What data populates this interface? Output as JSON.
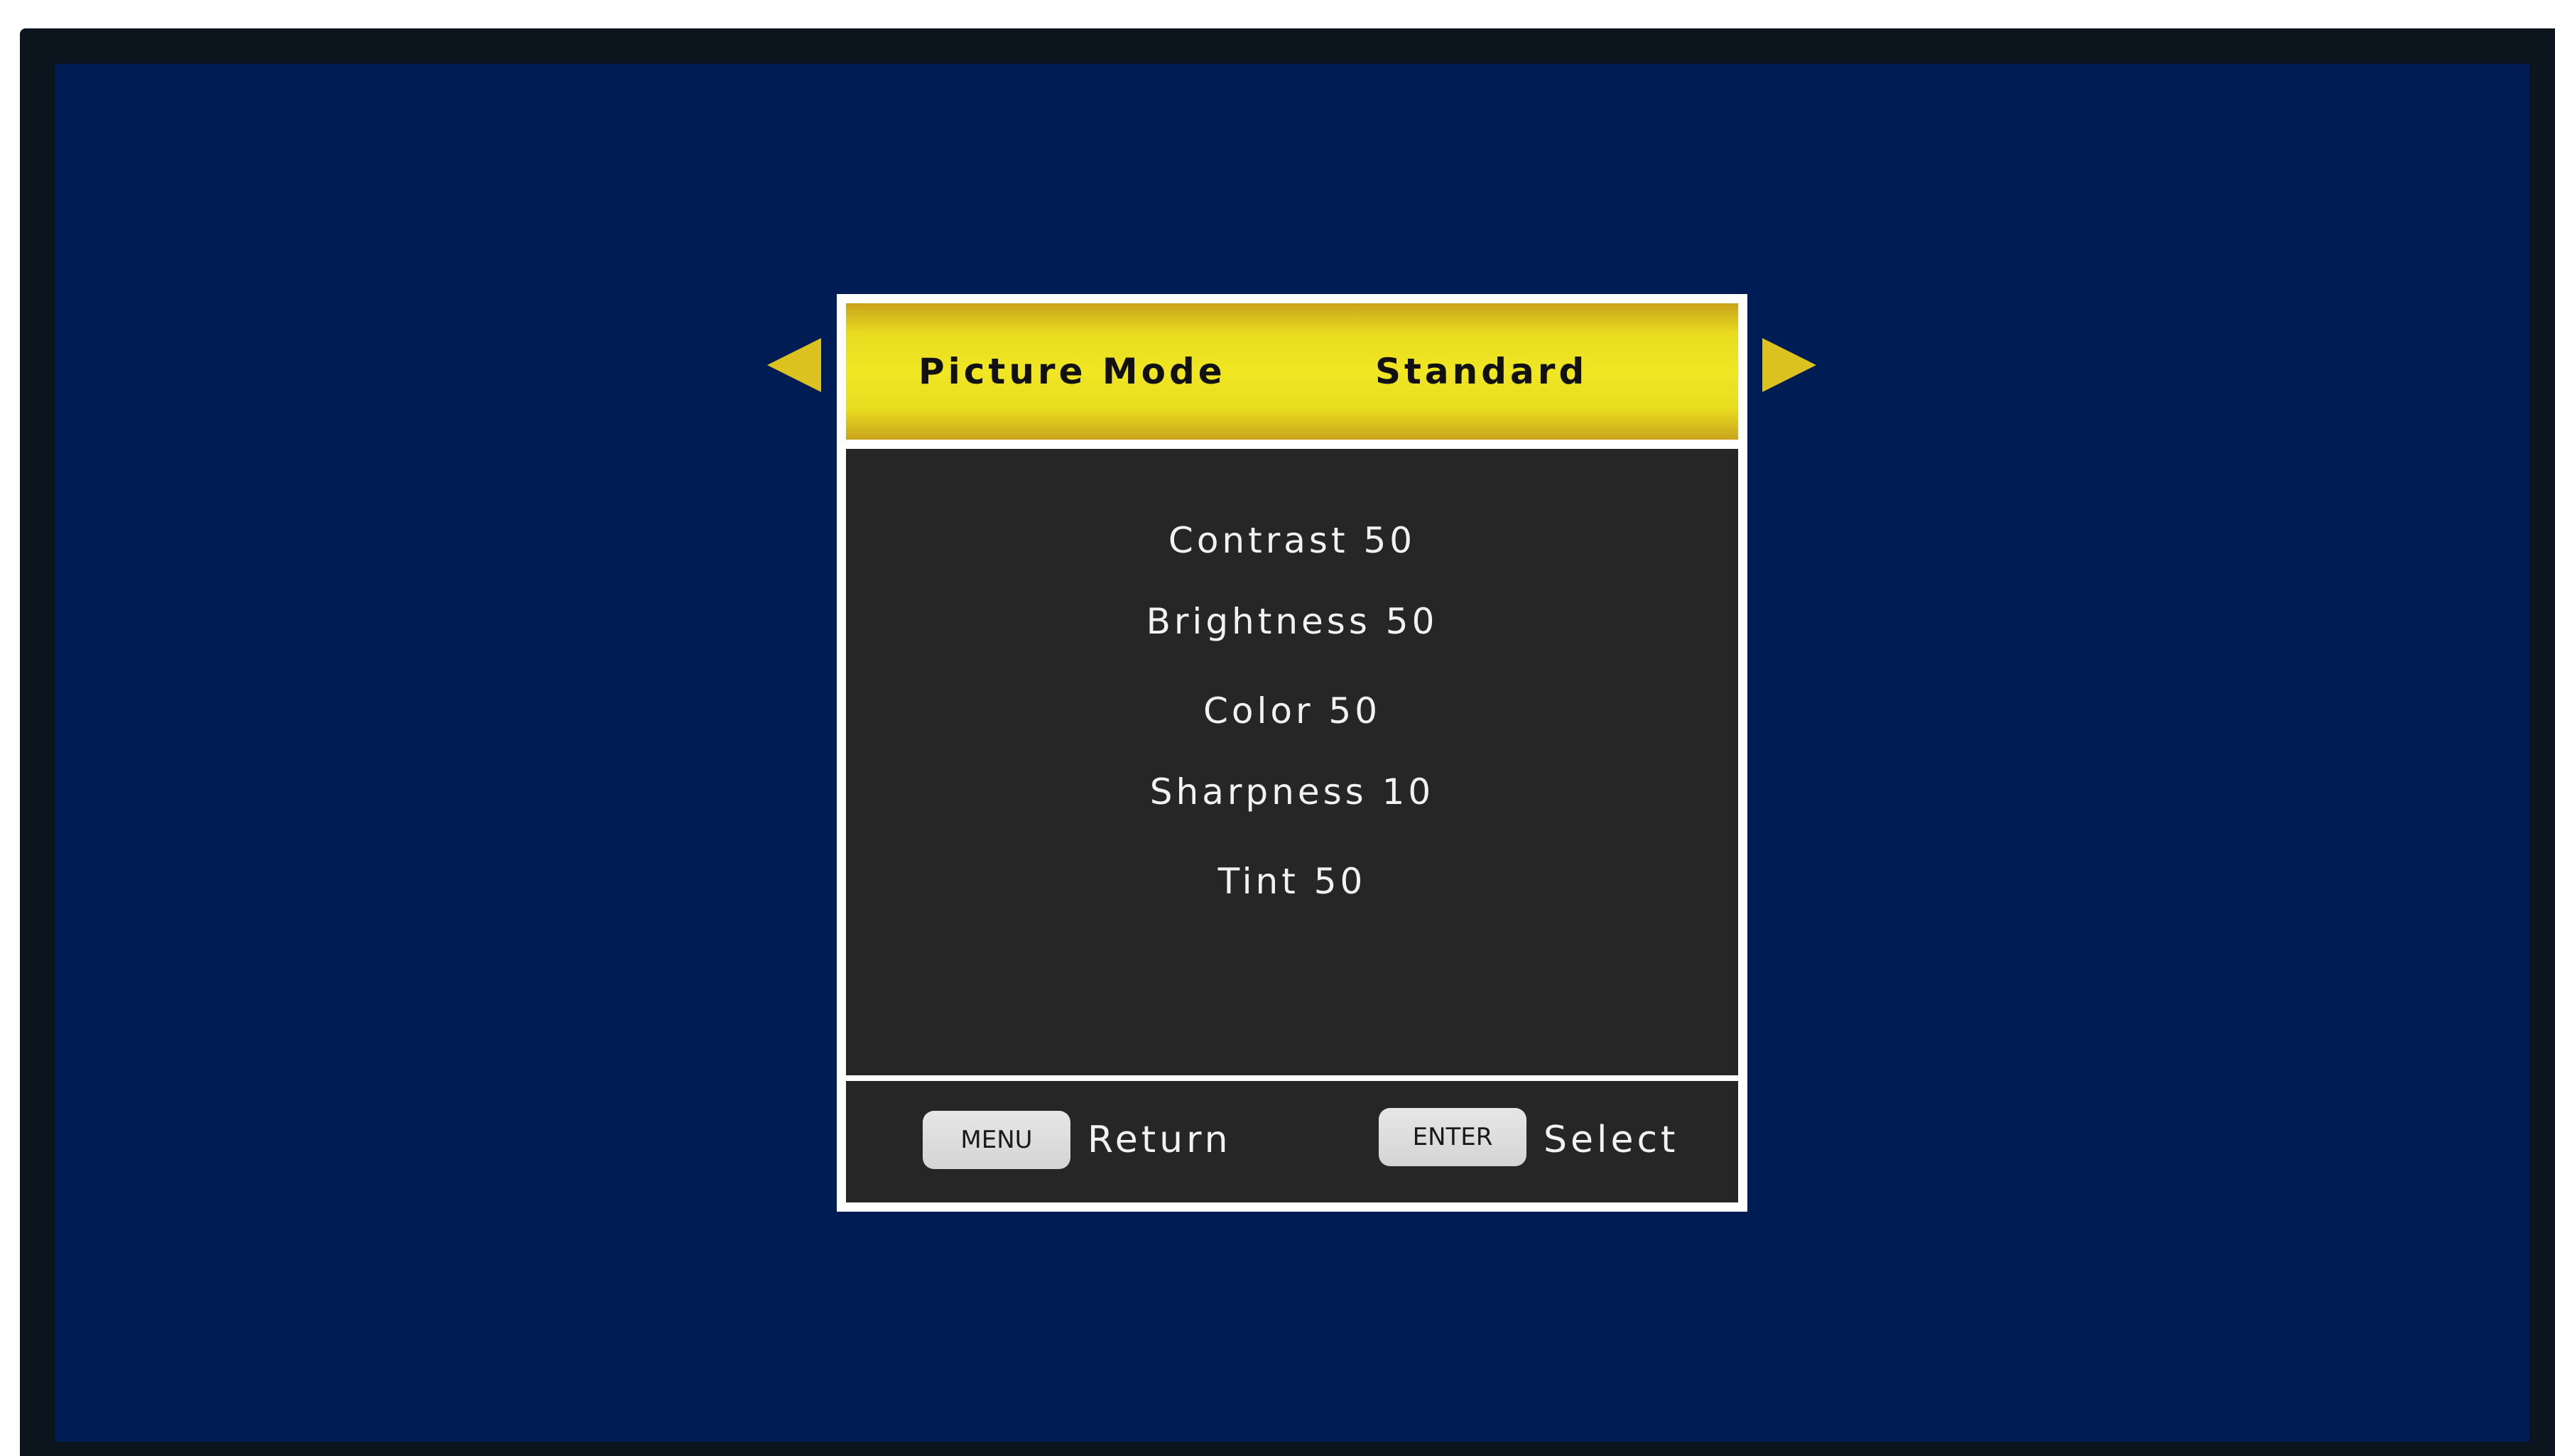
{
  "osd": {
    "header": {
      "label": "Picture Mode",
      "value": "Standard"
    },
    "settings": [
      {
        "text": "Contrast 50"
      },
      {
        "text": "Brightness 50"
      },
      {
        "text": "Color 50"
      },
      {
        "text": "Sharpness 10"
      },
      {
        "text": "Tint 50"
      }
    ],
    "footer": {
      "menu_key": "MENU",
      "menu_action": "Return",
      "enter_key": "ENTER",
      "enter_action": "Select"
    }
  },
  "colors": {
    "screen_background": "#001c55",
    "bezel": "#0c141e",
    "header_yellow": "#f0e622",
    "arrow_yellow": "#dcc21e",
    "panel_body": "#262626",
    "panel_border": "#ffffff",
    "key_badge": "#dcdcdc"
  },
  "icons": {
    "left_arrow": "triangle-left-icon",
    "right_arrow": "triangle-right-icon"
  }
}
